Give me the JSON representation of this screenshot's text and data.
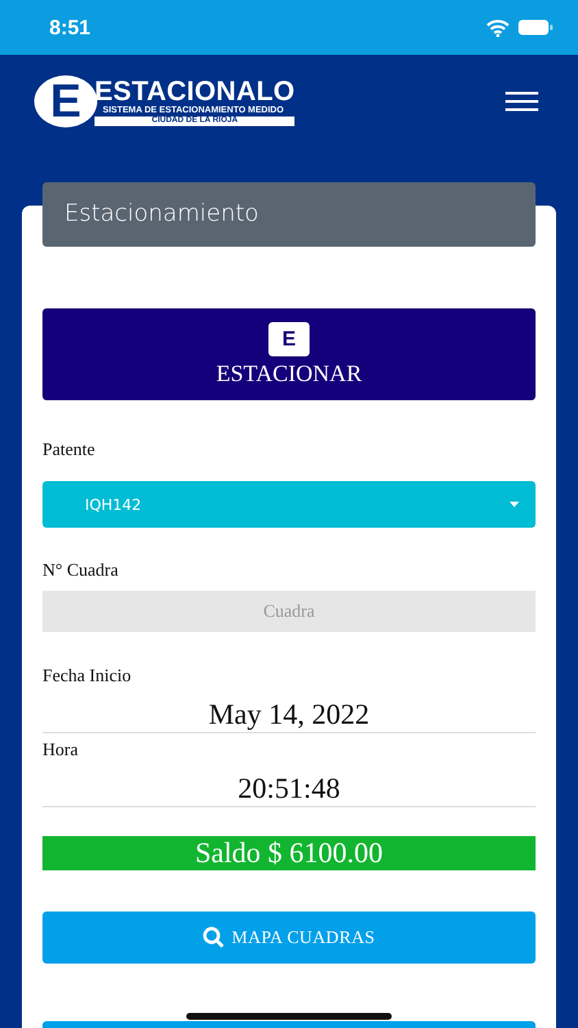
{
  "status_bar": {
    "time": "8:51"
  },
  "header": {
    "logo": {
      "letter": "E",
      "name": "ESTACIONALO",
      "tagline": "SISTEMA DE ESTACIONAMIENTO MEDIDO",
      "city": "CIUDAD DE LA RIOJA"
    }
  },
  "card": {
    "title": "Estacionamiento",
    "park_button": {
      "icon_letter": "E",
      "label": "ESTACIONAR"
    },
    "plate": {
      "label": "Patente",
      "value": "IQH142"
    },
    "block": {
      "label": "N° Cuadra",
      "placeholder": "Cuadra"
    },
    "start_date": {
      "label": "Fecha Inicio",
      "value": "May 14, 2022"
    },
    "time": {
      "label": "Hora",
      "value": "20:51:48"
    },
    "balance": "Saldo $ 6100.00",
    "map_button": {
      "label": "MAPA CUADRAS"
    }
  }
}
